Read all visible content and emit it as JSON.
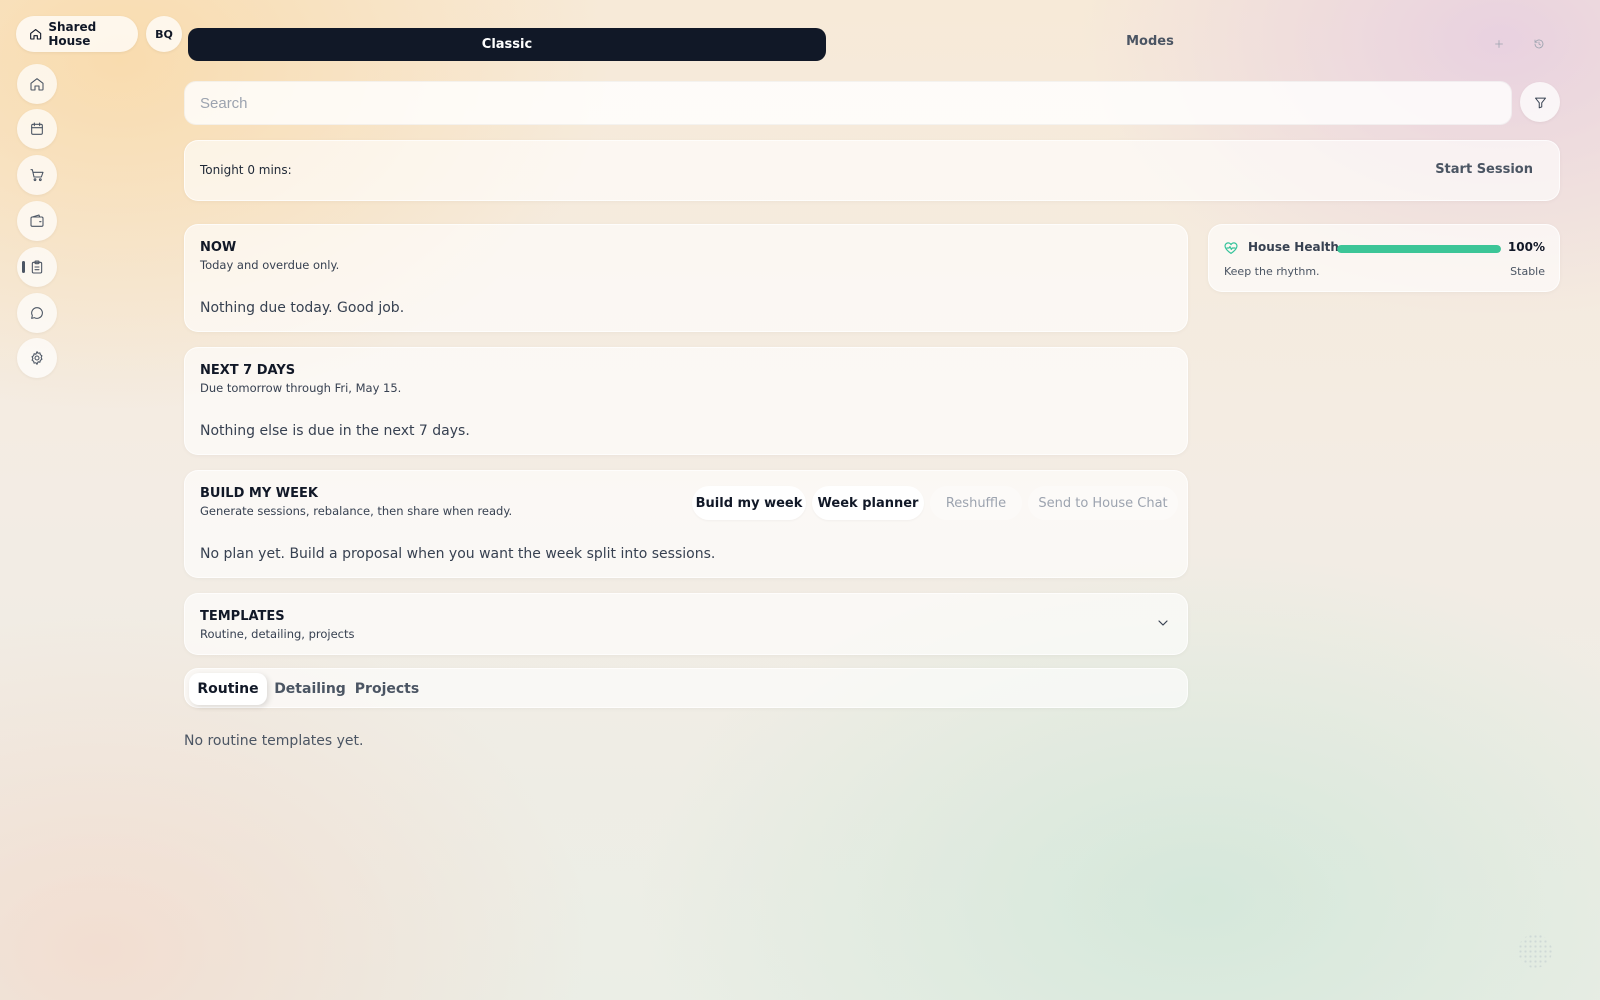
{
  "header": {
    "house_name": "Shared House",
    "user_initials": "BQ",
    "mode_active": "Classic",
    "modes_label": "Modes"
  },
  "sidebar": {
    "items": [
      {
        "icon": "home-icon"
      },
      {
        "icon": "calendar-icon"
      },
      {
        "icon": "cart-icon"
      },
      {
        "icon": "wallet-icon"
      },
      {
        "icon": "clipboard-icon",
        "active": true
      },
      {
        "icon": "chat-icon"
      },
      {
        "icon": "gear-icon"
      }
    ]
  },
  "search": {
    "placeholder": "Search"
  },
  "session": {
    "label": "Tonight 0 mins:",
    "start_label": "Start Session"
  },
  "now": {
    "title": "NOW",
    "subtitle": "Today and overdue only.",
    "empty": "Nothing due today. Good job."
  },
  "next7": {
    "title": "NEXT 7 DAYS",
    "subtitle": "Due tomorrow through Fri, May 15.",
    "empty": "Nothing else is due in the next 7 days."
  },
  "build_week": {
    "title": "BUILD MY WEEK",
    "subtitle": "Generate sessions, rebalance, then share when ready.",
    "buttons": [
      "Build my week",
      "Week planner",
      "Reshuffle",
      "Send to House Chat"
    ],
    "empty": "No plan yet. Build a proposal when you want the week split into sessions."
  },
  "templates": {
    "title": "TEMPLATES",
    "subtitle": "Routine, detailing, projects",
    "tabs": [
      "Routine",
      "Detailing",
      "Projects"
    ],
    "active_tab": "Routine",
    "empty": "No routine templates yet."
  },
  "house_health": {
    "title": "House Health",
    "percent_label": "100%",
    "percent": 100,
    "subtitle": "Keep the rhythm.",
    "status": "Stable",
    "color": "#3cc597"
  }
}
